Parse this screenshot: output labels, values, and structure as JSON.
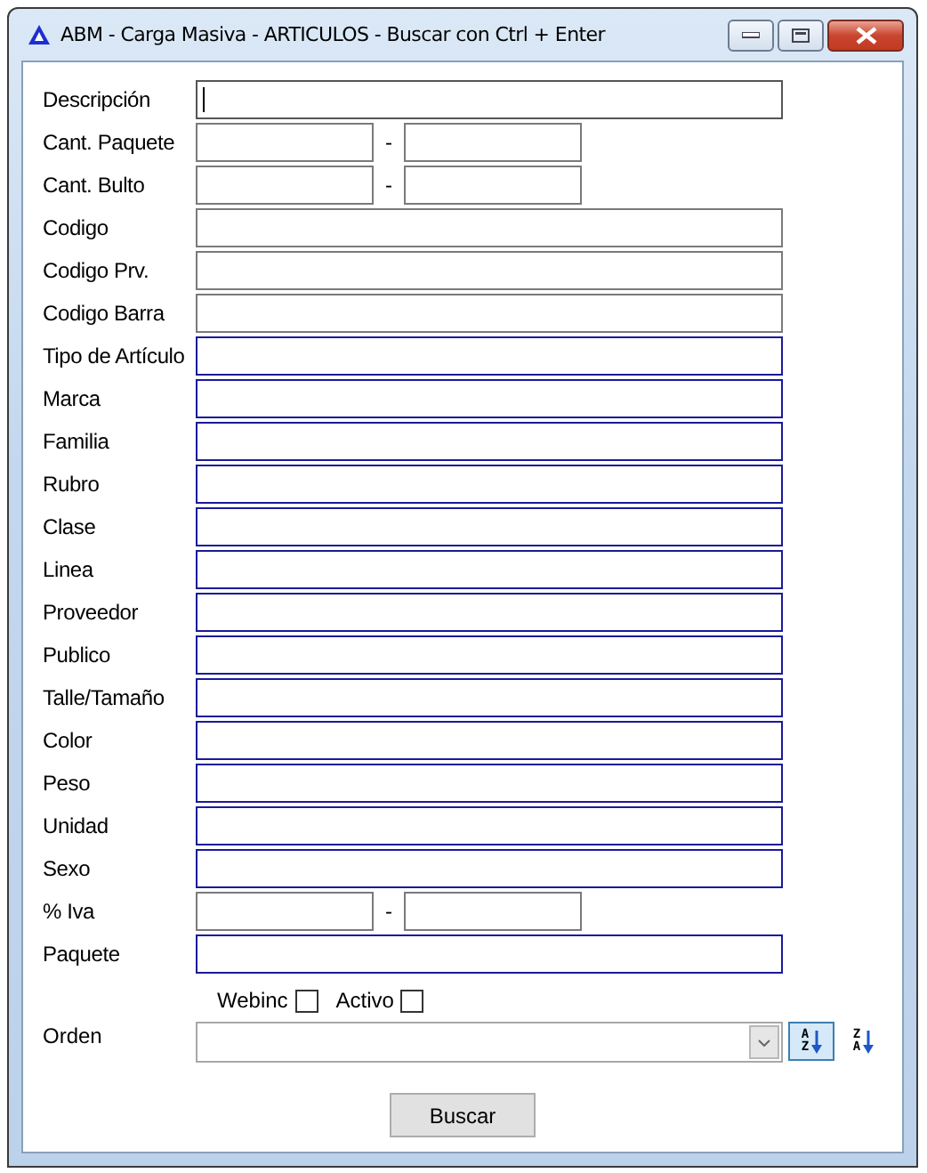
{
  "window": {
    "title": "ABM - Carga Masiva - ARTICULOS - Buscar con Ctrl + Enter"
  },
  "fields": [
    {
      "label": "Descripción",
      "kind": "text",
      "focused": true
    },
    {
      "label": "Cant. Paquete",
      "kind": "range",
      "separator": "-",
      "focused": false
    },
    {
      "label": "Cant. Bulto",
      "kind": "range",
      "separator": "-",
      "focused": false
    },
    {
      "label": "Codigo",
      "kind": "text",
      "focused": false
    },
    {
      "label": "Codigo Prv.",
      "kind": "text",
      "focused": false
    },
    {
      "label": "Codigo Barra",
      "kind": "text",
      "focused": false
    },
    {
      "label": "Tipo de Artículo",
      "kind": "lookup",
      "focused": false
    },
    {
      "label": "Marca",
      "kind": "lookup",
      "focused": false
    },
    {
      "label": "Familia",
      "kind": "lookup",
      "focused": false
    },
    {
      "label": "Rubro",
      "kind": "lookup",
      "focused": false
    },
    {
      "label": "Clase",
      "kind": "lookup",
      "focused": false
    },
    {
      "label": "Linea",
      "kind": "lookup",
      "focused": false
    },
    {
      "label": "Proveedor",
      "kind": "lookup",
      "focused": false
    },
    {
      "label": "Publico",
      "kind": "lookup",
      "focused": false
    },
    {
      "label": "Talle/Tamaño",
      "kind": "lookup",
      "focused": false
    },
    {
      "label": "Color",
      "kind": "lookup",
      "focused": false
    },
    {
      "label": "Peso",
      "kind": "lookup",
      "focused": false
    },
    {
      "label": "Unidad",
      "kind": "lookup",
      "focused": false
    },
    {
      "label": "Sexo",
      "kind": "lookup",
      "focused": false
    },
    {
      "label": "% Iva",
      "kind": "range",
      "separator": "-",
      "focused": false
    },
    {
      "label": "Paquete",
      "kind": "lookup",
      "focused": false
    }
  ],
  "checkboxes": [
    {
      "label": "Webinc",
      "checked": false
    },
    {
      "label": "Activo",
      "checked": false
    }
  ],
  "order": {
    "label": "Orden"
  },
  "sort_buttons": [
    {
      "top": "A",
      "bottom": "Z",
      "selected": true
    },
    {
      "top": "Z",
      "bottom": "A",
      "selected": false
    }
  ],
  "buttons": [
    "Buscar"
  ]
}
